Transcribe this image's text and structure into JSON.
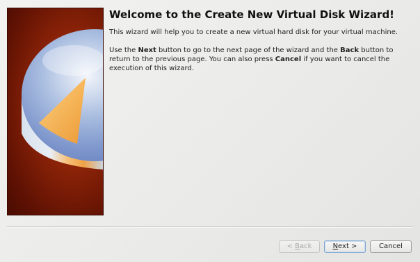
{
  "wizard": {
    "title": "Welcome to the Create New Virtual Disk Wizard!",
    "intro": "This wizard will help you to create a new virtual hard disk for your virtual machine.",
    "instructions": {
      "part1": "Use the ",
      "next_word": "Next",
      "part2": " button to go to the next page of the wizard and the ",
      "back_word": "Back",
      "part3": " button to return to the previous page. You can also press ",
      "cancel_word": "Cancel",
      "part4": " if you want to cancel the execution of this wizard."
    }
  },
  "buttons": {
    "back": {
      "prefix": "< ",
      "mnemonic": "B",
      "rest": "ack",
      "enabled": false
    },
    "next": {
      "mnemonic": "N",
      "rest": "ext >",
      "enabled": true,
      "default": true
    },
    "cancel": {
      "label": "Cancel",
      "enabled": true
    }
  },
  "banner": {
    "icon": "virtual-disk-icon",
    "background_color": "#8e2408"
  }
}
